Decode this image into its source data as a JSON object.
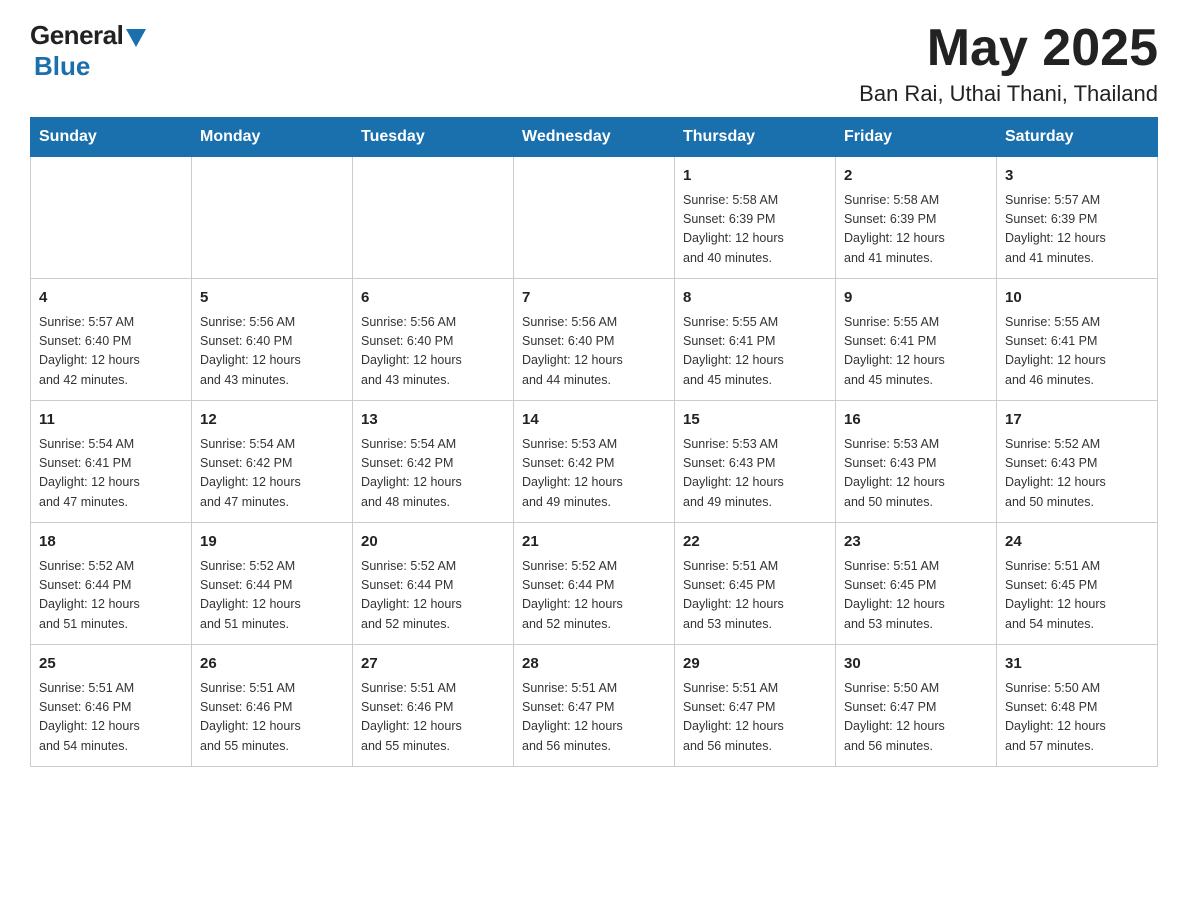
{
  "header": {
    "logo": {
      "general": "General",
      "blue": "Blue"
    },
    "title": "May 2025",
    "location": "Ban Rai, Uthai Thani, Thailand"
  },
  "days_of_week": [
    "Sunday",
    "Monday",
    "Tuesday",
    "Wednesday",
    "Thursday",
    "Friday",
    "Saturday"
  ],
  "weeks": [
    [
      {
        "day": "",
        "info": ""
      },
      {
        "day": "",
        "info": ""
      },
      {
        "day": "",
        "info": ""
      },
      {
        "day": "",
        "info": ""
      },
      {
        "day": "1",
        "info": "Sunrise: 5:58 AM\nSunset: 6:39 PM\nDaylight: 12 hours\nand 40 minutes."
      },
      {
        "day": "2",
        "info": "Sunrise: 5:58 AM\nSunset: 6:39 PM\nDaylight: 12 hours\nand 41 minutes."
      },
      {
        "day": "3",
        "info": "Sunrise: 5:57 AM\nSunset: 6:39 PM\nDaylight: 12 hours\nand 41 minutes."
      }
    ],
    [
      {
        "day": "4",
        "info": "Sunrise: 5:57 AM\nSunset: 6:40 PM\nDaylight: 12 hours\nand 42 minutes."
      },
      {
        "day": "5",
        "info": "Sunrise: 5:56 AM\nSunset: 6:40 PM\nDaylight: 12 hours\nand 43 minutes."
      },
      {
        "day": "6",
        "info": "Sunrise: 5:56 AM\nSunset: 6:40 PM\nDaylight: 12 hours\nand 43 minutes."
      },
      {
        "day": "7",
        "info": "Sunrise: 5:56 AM\nSunset: 6:40 PM\nDaylight: 12 hours\nand 44 minutes."
      },
      {
        "day": "8",
        "info": "Sunrise: 5:55 AM\nSunset: 6:41 PM\nDaylight: 12 hours\nand 45 minutes."
      },
      {
        "day": "9",
        "info": "Sunrise: 5:55 AM\nSunset: 6:41 PM\nDaylight: 12 hours\nand 45 minutes."
      },
      {
        "day": "10",
        "info": "Sunrise: 5:55 AM\nSunset: 6:41 PM\nDaylight: 12 hours\nand 46 minutes."
      }
    ],
    [
      {
        "day": "11",
        "info": "Sunrise: 5:54 AM\nSunset: 6:41 PM\nDaylight: 12 hours\nand 47 minutes."
      },
      {
        "day": "12",
        "info": "Sunrise: 5:54 AM\nSunset: 6:42 PM\nDaylight: 12 hours\nand 47 minutes."
      },
      {
        "day": "13",
        "info": "Sunrise: 5:54 AM\nSunset: 6:42 PM\nDaylight: 12 hours\nand 48 minutes."
      },
      {
        "day": "14",
        "info": "Sunrise: 5:53 AM\nSunset: 6:42 PM\nDaylight: 12 hours\nand 49 minutes."
      },
      {
        "day": "15",
        "info": "Sunrise: 5:53 AM\nSunset: 6:43 PM\nDaylight: 12 hours\nand 49 minutes."
      },
      {
        "day": "16",
        "info": "Sunrise: 5:53 AM\nSunset: 6:43 PM\nDaylight: 12 hours\nand 50 minutes."
      },
      {
        "day": "17",
        "info": "Sunrise: 5:52 AM\nSunset: 6:43 PM\nDaylight: 12 hours\nand 50 minutes."
      }
    ],
    [
      {
        "day": "18",
        "info": "Sunrise: 5:52 AM\nSunset: 6:44 PM\nDaylight: 12 hours\nand 51 minutes."
      },
      {
        "day": "19",
        "info": "Sunrise: 5:52 AM\nSunset: 6:44 PM\nDaylight: 12 hours\nand 51 minutes."
      },
      {
        "day": "20",
        "info": "Sunrise: 5:52 AM\nSunset: 6:44 PM\nDaylight: 12 hours\nand 52 minutes."
      },
      {
        "day": "21",
        "info": "Sunrise: 5:52 AM\nSunset: 6:44 PM\nDaylight: 12 hours\nand 52 minutes."
      },
      {
        "day": "22",
        "info": "Sunrise: 5:51 AM\nSunset: 6:45 PM\nDaylight: 12 hours\nand 53 minutes."
      },
      {
        "day": "23",
        "info": "Sunrise: 5:51 AM\nSunset: 6:45 PM\nDaylight: 12 hours\nand 53 minutes."
      },
      {
        "day": "24",
        "info": "Sunrise: 5:51 AM\nSunset: 6:45 PM\nDaylight: 12 hours\nand 54 minutes."
      }
    ],
    [
      {
        "day": "25",
        "info": "Sunrise: 5:51 AM\nSunset: 6:46 PM\nDaylight: 12 hours\nand 54 minutes."
      },
      {
        "day": "26",
        "info": "Sunrise: 5:51 AM\nSunset: 6:46 PM\nDaylight: 12 hours\nand 55 minutes."
      },
      {
        "day": "27",
        "info": "Sunrise: 5:51 AM\nSunset: 6:46 PM\nDaylight: 12 hours\nand 55 minutes."
      },
      {
        "day": "28",
        "info": "Sunrise: 5:51 AM\nSunset: 6:47 PM\nDaylight: 12 hours\nand 56 minutes."
      },
      {
        "day": "29",
        "info": "Sunrise: 5:51 AM\nSunset: 6:47 PM\nDaylight: 12 hours\nand 56 minutes."
      },
      {
        "day": "30",
        "info": "Sunrise: 5:50 AM\nSunset: 6:47 PM\nDaylight: 12 hours\nand 56 minutes."
      },
      {
        "day": "31",
        "info": "Sunrise: 5:50 AM\nSunset: 6:48 PM\nDaylight: 12 hours\nand 57 minutes."
      }
    ]
  ]
}
